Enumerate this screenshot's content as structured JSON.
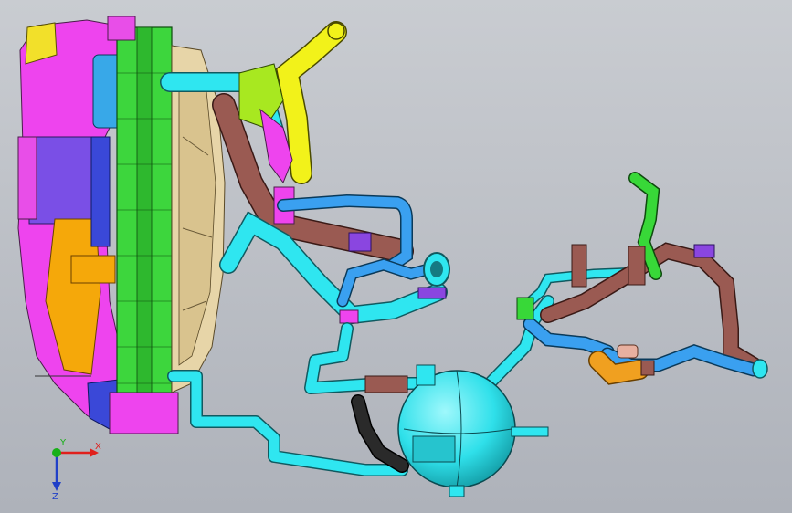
{
  "view": {
    "background_top": "#c9ccd1",
    "background_bottom": "#aeb2ba"
  },
  "triad": {
    "x_label": "X",
    "y_label": "Y",
    "z_label": "Z",
    "x_color": "#e0201c",
    "y_color": "#18b018",
    "z_color": "#2040c8"
  },
  "colors": {
    "radiator_core": "#3dd63d",
    "shroud_beige": "#e7d5a8",
    "housing_magenta": "#ee44ee",
    "hose_cyan": "#2fe6f0",
    "hose_blue": "#3aa0f0",
    "hose_brown": "#9a5a52",
    "filler_yellow": "#f2f21a",
    "reservoir_cyan": "#2fe0ea",
    "hose_orange": "#f0a020",
    "hose_green": "#38d838",
    "hose_black": "#2a2a2a",
    "purple_clamp": "#8a46e0"
  }
}
